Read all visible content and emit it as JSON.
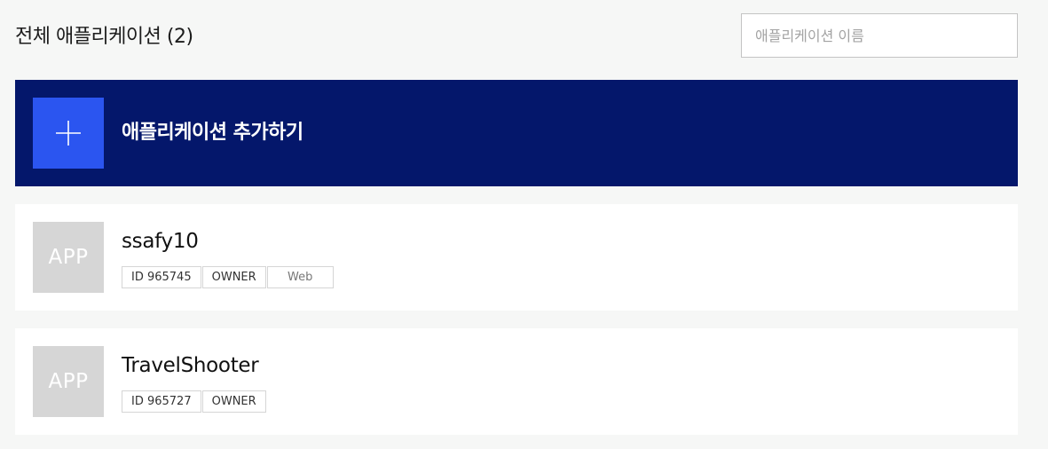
{
  "header": {
    "title": "전체 애플리케이션 (2)",
    "search_placeholder": "애플리케이션 이름"
  },
  "add_app": {
    "label": "애플리케이션 추가하기",
    "icon": "plus-icon"
  },
  "apps": [
    {
      "thumb_label": "APP",
      "name": "ssafy10",
      "id_label": "ID 965745",
      "role": "OWNER",
      "platform": "Web"
    },
    {
      "thumb_label": "APP",
      "name": "TravelShooter",
      "id_label": "ID 965727",
      "role": "OWNER"
    }
  ],
  "colors": {
    "background": "#f6f7f6",
    "add_banner": "#04176b",
    "add_icon_box": "#2b55f0",
    "thumb": "#d6d6d6"
  }
}
